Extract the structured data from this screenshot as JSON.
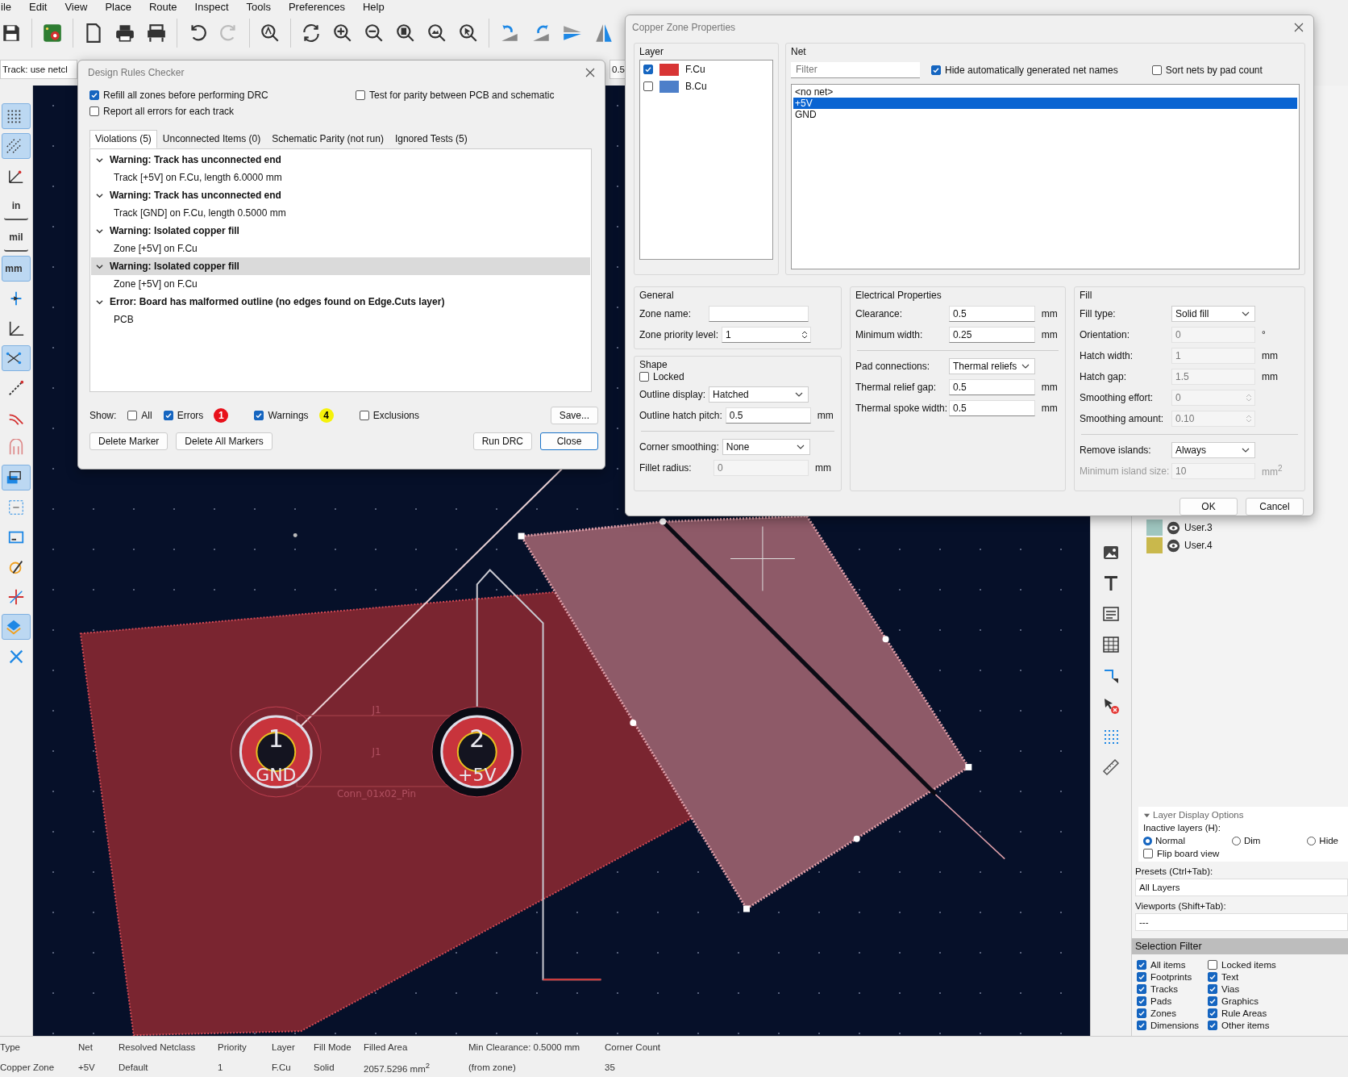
{
  "menu_bar": [
    "ile",
    "Edit",
    "View",
    "Place",
    "Route",
    "Inspect",
    "Tools",
    "Preferences",
    "Help"
  ],
  "aux_toolbar": {
    "track_width": "Track: use netcl",
    "via_size": "0.5"
  },
  "left_toolbar": [
    {
      "kind": "icon",
      "selected": true
    },
    {
      "kind": "icon",
      "selected": true
    },
    {
      "kind": "icon",
      "selected": false
    },
    {
      "kind": "text",
      "label": "in",
      "selected": false
    },
    {
      "kind": "text",
      "label": "mil",
      "selected": false
    },
    {
      "kind": "text",
      "label": "mm",
      "selected": true
    },
    {
      "kind": "icon",
      "selected": false
    },
    {
      "kind": "icon",
      "selected": false
    },
    {
      "kind": "icon",
      "selected": true
    },
    {
      "kind": "icon",
      "selected": false
    },
    {
      "kind": "icon",
      "selected": false
    },
    {
      "kind": "icon",
      "selected": false
    },
    {
      "kind": "icon",
      "selected": true
    },
    {
      "kind": "icon",
      "selected": false
    },
    {
      "kind": "icon",
      "selected": false
    },
    {
      "kind": "icon",
      "selected": false
    },
    {
      "kind": "icon",
      "selected": false
    },
    {
      "kind": "icon",
      "selected": true
    },
    {
      "kind": "icon",
      "selected": false
    }
  ],
  "canvas": {
    "pads": [
      {
        "number": "1",
        "net": "GND"
      },
      {
        "number": "2",
        "net": "+5V"
      }
    ],
    "references": [
      "J1",
      "J1"
    ],
    "value": "Conn_01x02_Pin"
  },
  "drc_dialog": {
    "title": "Design Rules Checker",
    "options": [
      {
        "label": "Refill all zones before performing DRC",
        "checked": true
      },
      {
        "label": "Test for parity between PCB and schematic",
        "checked": false
      },
      {
        "label": "Report all errors for each track",
        "checked": false
      }
    ],
    "tabs": [
      {
        "label": "Violations (5)",
        "selected": true
      },
      {
        "label": "Unconnected Items (0)",
        "selected": false
      },
      {
        "label": "Schematic Parity (not run)",
        "selected": false
      },
      {
        "label": "Ignored Tests (5)",
        "selected": false
      }
    ],
    "violations": [
      {
        "title": "Warning: Track has unconnected end",
        "detail": "Track [+5V] on F.Cu, length 6.0000 mm",
        "expanded": true,
        "selected": false
      },
      {
        "title": "Warning: Track has unconnected end",
        "detail": "Track [GND] on F.Cu, length 0.5000 mm",
        "expanded": true,
        "selected": false
      },
      {
        "title": "Warning: Isolated copper fill",
        "detail": "Zone [+5V] on F.Cu",
        "expanded": true,
        "selected": false
      },
      {
        "title": "Warning: Isolated copper fill",
        "detail": "Zone [+5V] on F.Cu",
        "expanded": true,
        "selected": true
      },
      {
        "title": "Error: Board has malformed outline (no edges found on Edge.Cuts layer)",
        "detail": "PCB",
        "expanded": true,
        "selected": false
      }
    ],
    "show_label": "Show:",
    "show_filters": [
      {
        "label": "All",
        "checked": false
      },
      {
        "label": "Errors",
        "checked": true,
        "count": "1",
        "color": "#e8101a"
      },
      {
        "label": "Warnings",
        "checked": true,
        "count": "4",
        "color": "#f5f20a"
      },
      {
        "label": "Exclusions",
        "checked": false
      }
    ],
    "save_button": "Save...",
    "buttons": [
      {
        "label": "Delete Marker",
        "default": false
      },
      {
        "label": "Delete All Markers",
        "default": false
      },
      {
        "label": "Run DRC",
        "default": false
      },
      {
        "label": "Close",
        "default": true
      }
    ]
  },
  "zone_dialog": {
    "title": "Copper Zone Properties",
    "layer": {
      "heading": "Layer",
      "layers": [
        {
          "name": "F.Cu",
          "checked": true,
          "color": "#d83535"
        },
        {
          "name": "B.Cu",
          "checked": false,
          "color": "#4d7fc9"
        }
      ]
    },
    "net": {
      "heading": "Net",
      "filter": {
        "placeholder": "Filter"
      },
      "options": [
        {
          "label": "Hide automatically generated net names",
          "checked": true
        },
        {
          "label": "Sort nets by pad count",
          "checked": false
        }
      ],
      "nets": [
        {
          "name": "<no net>",
          "selected": false
        },
        {
          "name": "+5V",
          "selected": true
        },
        {
          "name": "GND",
          "selected": false
        }
      ]
    },
    "columns": [
      {
        "sections": [
          {
            "heading": "General",
            "rows": [
              {
                "kind": "text",
                "label": "Zone name:",
                "disabled": false
              },
              {
                "kind": "spin",
                "label": "Zone priority level:",
                "value": "1",
                "disabled": false
              }
            ]
          },
          {
            "heading": "Shape",
            "rows": [
              {
                "kind": "checkbox",
                "label": "Locked",
                "checked": false
              },
              {
                "kind": "select",
                "label": "Outline display:",
                "value": "Hatched",
                "disabled": false
              },
              {
                "kind": "text",
                "label": "Outline hatch pitch:",
                "value": "0.5",
                "unit": "mm",
                "disabled": false
              },
              {
                "kind": "divider"
              },
              {
                "kind": "select",
                "label": "Corner smoothing:",
                "value": "None",
                "disabled": false
              },
              {
                "kind": "text",
                "label": "Fillet radius:",
                "value": "0",
                "unit": "mm",
                "disabled": true
              }
            ]
          }
        ]
      },
      {
        "sections": [
          {
            "heading": "Electrical Properties",
            "rows": [
              {
                "kind": "text",
                "label": "Clearance:",
                "value": "0.5",
                "unit": "mm",
                "disabled": false
              },
              {
                "kind": "text",
                "label": "Minimum width:",
                "value": "0.25",
                "unit": "mm",
                "disabled": false
              },
              {
                "kind": "divider"
              },
              {
                "kind": "select",
                "label": "Pad connections:",
                "value": "Thermal reliefs",
                "disabled": false
              },
              {
                "kind": "text",
                "label": "Thermal relief gap:",
                "value": "0.5",
                "unit": "mm",
                "disabled": false
              },
              {
                "kind": "text",
                "label": "Thermal spoke width:",
                "value": "0.5",
                "unit": "mm",
                "disabled": false
              }
            ]
          }
        ]
      },
      {
        "sections": [
          {
            "heading": "Fill",
            "rows": [
              {
                "kind": "select",
                "label": "Fill type:",
                "value": "Solid fill",
                "disabled": false
              },
              {
                "kind": "text",
                "label": "Orientation:",
                "value": "0",
                "unit": "°",
                "disabled": true
              },
              {
                "kind": "text",
                "label": "Hatch width:",
                "value": "1",
                "unit": "mm",
                "disabled": true
              },
              {
                "kind": "text",
                "label": "Hatch gap:",
                "value": "1.5",
                "unit": "mm",
                "disabled": true
              },
              {
                "kind": "spin",
                "label": "Smoothing effort:",
                "value": "0",
                "disabled": true
              },
              {
                "kind": "spin",
                "label": "Smoothing amount:",
                "value": "0.10",
                "disabled": true
              },
              {
                "kind": "divider"
              },
              {
                "kind": "select",
                "label": "Remove islands:",
                "value": "Always",
                "disabled": false
              },
              {
                "kind": "text",
                "label": "Minimum island size:",
                "value": "10",
                "unit": "mm$^{2}$",
                "disabled": true,
                "label_disabled": true
              }
            ]
          }
        ]
      }
    ],
    "buttons": [
      "OK",
      "Cancel"
    ]
  },
  "layers_panel": {
    "layers": [
      {
        "name": "User.3",
        "color": "#9fc6c0",
        "visible": true
      },
      {
        "name": "User.4",
        "color": "#c9b84c",
        "visible": true
      }
    ],
    "display_options": {
      "heading": "Layer Display Options",
      "expanded": true,
      "inactive_label": "Inactive layers (H):",
      "inactive_modes": [
        {
          "label": "Normal",
          "selected": true
        },
        {
          "label": "Dim",
          "selected": false
        },
        {
          "label": "Hide",
          "selected": false
        }
      ],
      "flip_board": {
        "label": "Flip board view",
        "checked": false
      }
    },
    "presets": {
      "label": "Presets (Ctrl+Tab):",
      "value": "All Layers"
    },
    "viewports": {
      "label": "Viewports (Shift+Tab):",
      "value": "---"
    },
    "selection_filter": {
      "heading": "Selection Filter",
      "items": [
        {
          "label": "All items",
          "checked": true
        },
        {
          "label": "Footprints",
          "checked": true
        },
        {
          "label": "Tracks",
          "checked": true
        },
        {
          "label": "Pads",
          "checked": true
        },
        {
          "label": "Zones",
          "checked": true
        },
        {
          "label": "Dimensions",
          "checked": true
        },
        {
          "label": "Locked items",
          "checked": false
        },
        {
          "label": "Text",
          "checked": true
        },
        {
          "label": "Vias",
          "checked": true
        },
        {
          "label": "Graphics",
          "checked": true
        },
        {
          "label": "Rule Areas",
          "checked": true
        },
        {
          "label": "Other items",
          "checked": true
        }
      ]
    }
  },
  "status_bar": [
    {
      "label": "Type",
      "value": "Copper Zone"
    },
    {
      "label": "Net",
      "value": "+5V"
    },
    {
      "label": "Resolved Netclass",
      "value": "Default"
    },
    {
      "label": "Priority",
      "value": "1"
    },
    {
      "label": "Layer",
      "value": "F.Cu"
    },
    {
      "label": "Fill Mode",
      "value": "Solid"
    },
    {
      "label": "Filled Area",
      "value": "2057.5296 mm$^{2}$"
    },
    {
      "label": "Min Clearance: 0.5000 mm",
      "value": "(from zone)"
    },
    {
      "label": "Corner Count",
      "value": "35"
    }
  ]
}
